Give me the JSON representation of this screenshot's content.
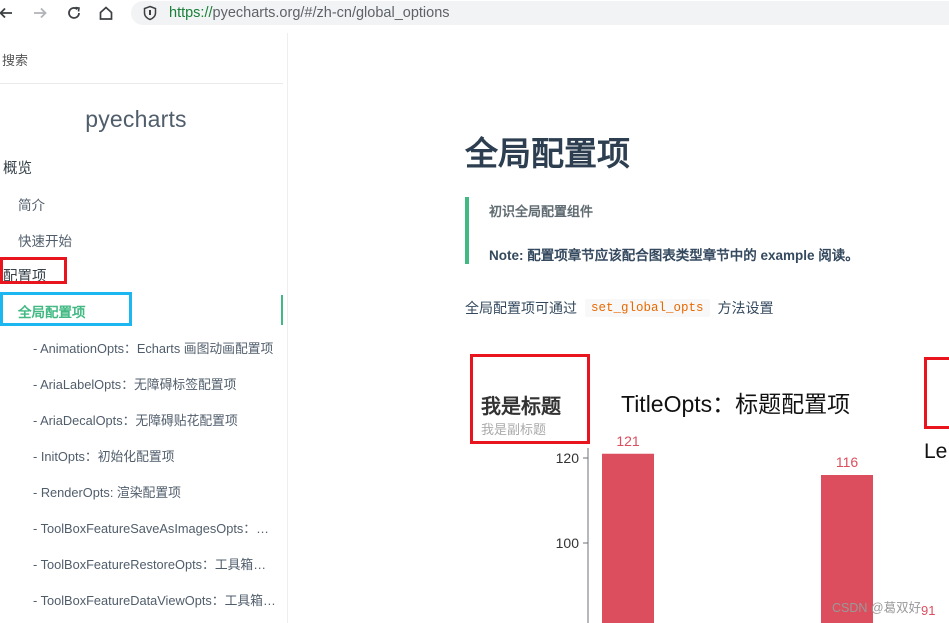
{
  "browser": {
    "url_scheme": "https://",
    "url_rest": "pyecharts.org/#/zh-cn/global_options"
  },
  "sidebar": {
    "search_label": "搜索",
    "app_name": "pyecharts",
    "items": [
      {
        "label": "概览",
        "level": 1
      },
      {
        "label": "简介",
        "level": 2
      },
      {
        "label": "快速开始",
        "level": 2
      },
      {
        "label": "配置项",
        "level": 1
      },
      {
        "label": "全局配置项",
        "level": 2,
        "active": true
      },
      {
        "label": "- AnimationOpts：Echarts 画图动画配置项",
        "level": 3
      },
      {
        "label": "- AriaLabelOpts：无障碍标签配置项",
        "level": 3
      },
      {
        "label": "- AriaDecalOpts：无障碍贴花配置项",
        "level": 3
      },
      {
        "label": "- InitOpts：初始化配置项",
        "level": 3
      },
      {
        "label": "- RenderOpts: 渲染配置项",
        "level": 3
      },
      {
        "label": "- ToolBoxFeatureSaveAsImagesOpts：工具箱保存图片配置项",
        "level": 3
      },
      {
        "label": "- ToolBoxFeatureRestoreOpts：工具箱还原配置项",
        "level": 3
      },
      {
        "label": "- ToolBoxFeatureDataViewOpts：工具箱数据视图工具",
        "level": 3
      }
    ]
  },
  "main": {
    "title": "全局配置项",
    "quote_line1": "初识全局配置组件",
    "quote_line2": "Note: 配置项章节应该配合图表类型章节中的 example 阅读。",
    "intro_before": "全局配置项可通过",
    "intro_code": "set_global_opts",
    "intro_after": "方法设置"
  },
  "chart_data": {
    "type": "bar",
    "title": "我是标题",
    "subtitle": "我是副标题",
    "categories": [
      "",
      ""
    ],
    "series": [
      {
        "values": [
          121,
          116
        ]
      }
    ],
    "y_ticks": [
      100,
      120
    ],
    "ylim": [
      75,
      127
    ],
    "color": "#dc4e5e",
    "label_color": "#dc4e5e"
  },
  "annotations": {
    "title_opts_heading": "TitleOpts：标题配置项",
    "cutoff_text": "Le",
    "cutoff_value": "91",
    "watermark": "CSDN @葛双好"
  },
  "colors": {
    "accent": "#42b983",
    "highlight_red": "#e8141e",
    "highlight_cyan": "#1cb7f0"
  }
}
